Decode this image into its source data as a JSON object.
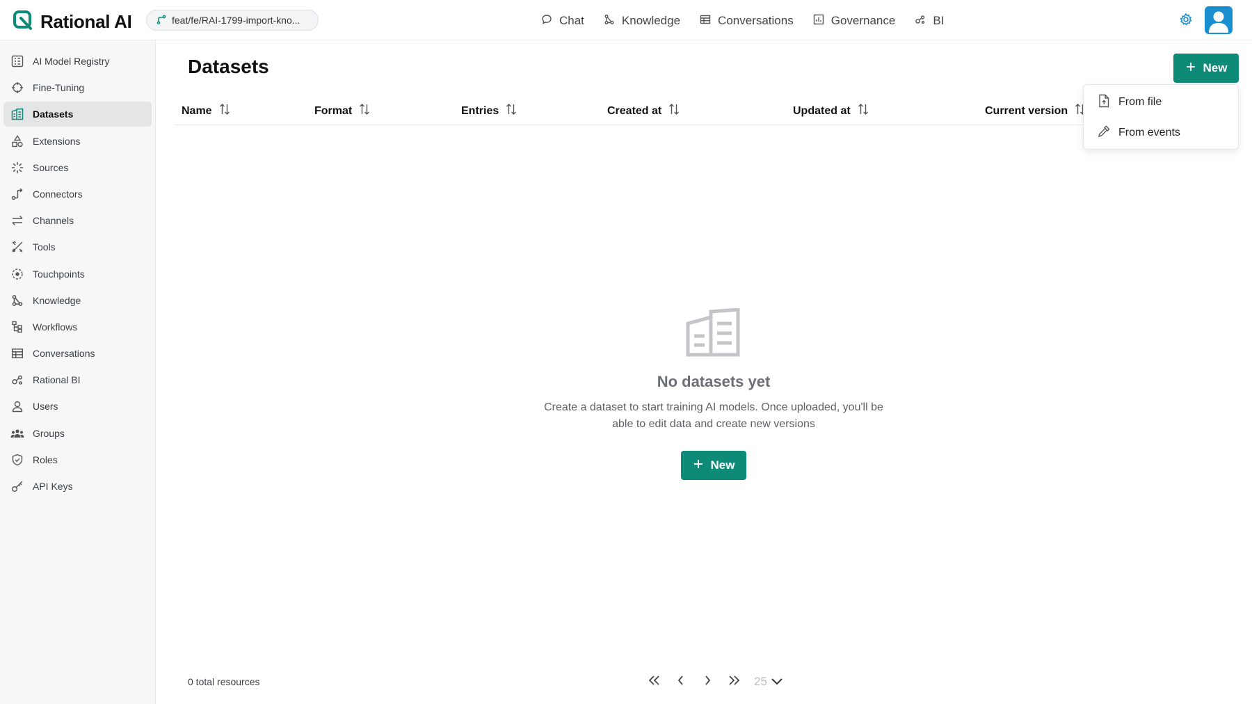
{
  "app": {
    "name": "Rational AI",
    "accent": "#0d8a78",
    "logo_color": "#0d8a78"
  },
  "branch": {
    "label": "feat/fe/RAI-1799-import-kno...",
    "icon": "git-branch-icon"
  },
  "topnav": [
    {
      "label": "Chat",
      "icon": "chat-bubble-icon"
    },
    {
      "label": "Knowledge",
      "icon": "knowledge-graph-icon"
    },
    {
      "label": "Conversations",
      "icon": "table-icon"
    },
    {
      "label": "Governance",
      "icon": "bar-chart-icon"
    },
    {
      "label": "BI",
      "icon": "bi-nodes-icon"
    }
  ],
  "sidebar": {
    "active": "Datasets",
    "items": [
      {
        "label": "AI Model Registry",
        "icon": "registry-icon"
      },
      {
        "label": "Fine-Tuning",
        "icon": "crosshair-icon"
      },
      {
        "label": "Datasets",
        "icon": "datasets-icon"
      },
      {
        "label": "Extensions",
        "icon": "shapes-icon"
      },
      {
        "label": "Sources",
        "icon": "sparkle-loader-icon"
      },
      {
        "label": "Connectors",
        "icon": "connector-icon"
      },
      {
        "label": "Channels",
        "icon": "arrows-exchange-icon"
      },
      {
        "label": "Tools",
        "icon": "tools-icon"
      },
      {
        "label": "Touchpoints",
        "icon": "touchpoint-icon"
      },
      {
        "label": "Knowledge",
        "icon": "knowledge-graph-icon"
      },
      {
        "label": "Workflows",
        "icon": "workflow-icon"
      },
      {
        "label": "Conversations",
        "icon": "table-icon"
      },
      {
        "label": "Rational BI",
        "icon": "bi-nodes-icon"
      },
      {
        "label": "Users",
        "icon": "user-icon"
      },
      {
        "label": "Groups",
        "icon": "group-icon"
      },
      {
        "label": "Roles",
        "icon": "shield-check-icon"
      },
      {
        "label": "API Keys",
        "icon": "key-icon"
      }
    ]
  },
  "page": {
    "title": "Datasets",
    "new_label": "New",
    "columns": [
      "Name",
      "Format",
      "Entries",
      "Created at",
      "Updated at",
      "Current version"
    ],
    "dropdown": [
      {
        "label": "From file",
        "icon": "file-upload-icon"
      },
      {
        "label": "From events",
        "icon": "pipette-icon"
      }
    ],
    "empty": {
      "title": "No datasets yet",
      "description": "Create a dataset to start training AI models. Once uploaded, you'll be able to edit data and create new versions",
      "button_label": "New"
    }
  },
  "footer": {
    "total": "0 total resources",
    "page_size": "25"
  }
}
